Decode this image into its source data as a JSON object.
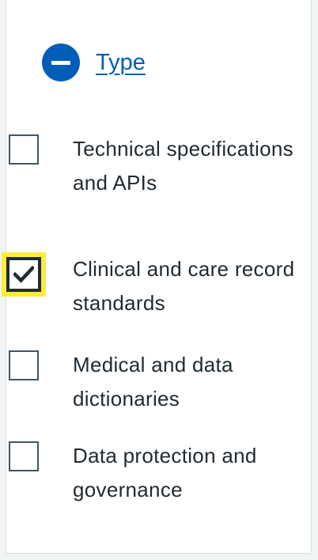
{
  "filter": {
    "title": "Type",
    "expanded": true,
    "toggle_icon": "minus-circle-icon",
    "colors": {
      "accent": "#005eb8",
      "text": "#212b32",
      "checkbox_border": "#425563",
      "focus": "#ffeb3b"
    },
    "options": [
      {
        "label": "Technical specifications and APIs",
        "checked": false
      },
      {
        "label": "Clinical and care record standards",
        "checked": true
      },
      {
        "label": "Medical and data dictionaries",
        "checked": false
      },
      {
        "label": "Data protection and governance",
        "checked": false
      }
    ]
  }
}
